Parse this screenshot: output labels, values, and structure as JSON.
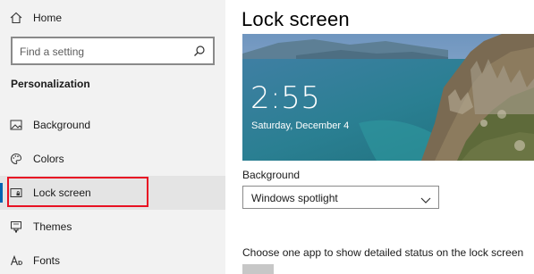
{
  "sidebar": {
    "home_label": "Home",
    "search_placeholder": "Find a setting",
    "section_title": "Personalization",
    "items": [
      {
        "label": "Background",
        "icon": "picture-icon"
      },
      {
        "label": "Colors",
        "icon": "palette-icon"
      },
      {
        "label": "Lock screen",
        "icon": "lock-screen-icon",
        "selected": true
      },
      {
        "label": "Themes",
        "icon": "brush-icon"
      },
      {
        "label": "Fonts",
        "icon": "font-icon"
      }
    ]
  },
  "main": {
    "title": "Lock screen",
    "preview": {
      "time": "2:55",
      "date": "Saturday, December 4"
    },
    "background_label": "Background",
    "background_value": "Windows spotlight",
    "status_label": "Choose one app to show detailed status on the lock screen"
  },
  "colors": {
    "accent": "#0063b1",
    "highlight_border": "#e81123",
    "sidebar_bg": "#f2f2f2"
  }
}
